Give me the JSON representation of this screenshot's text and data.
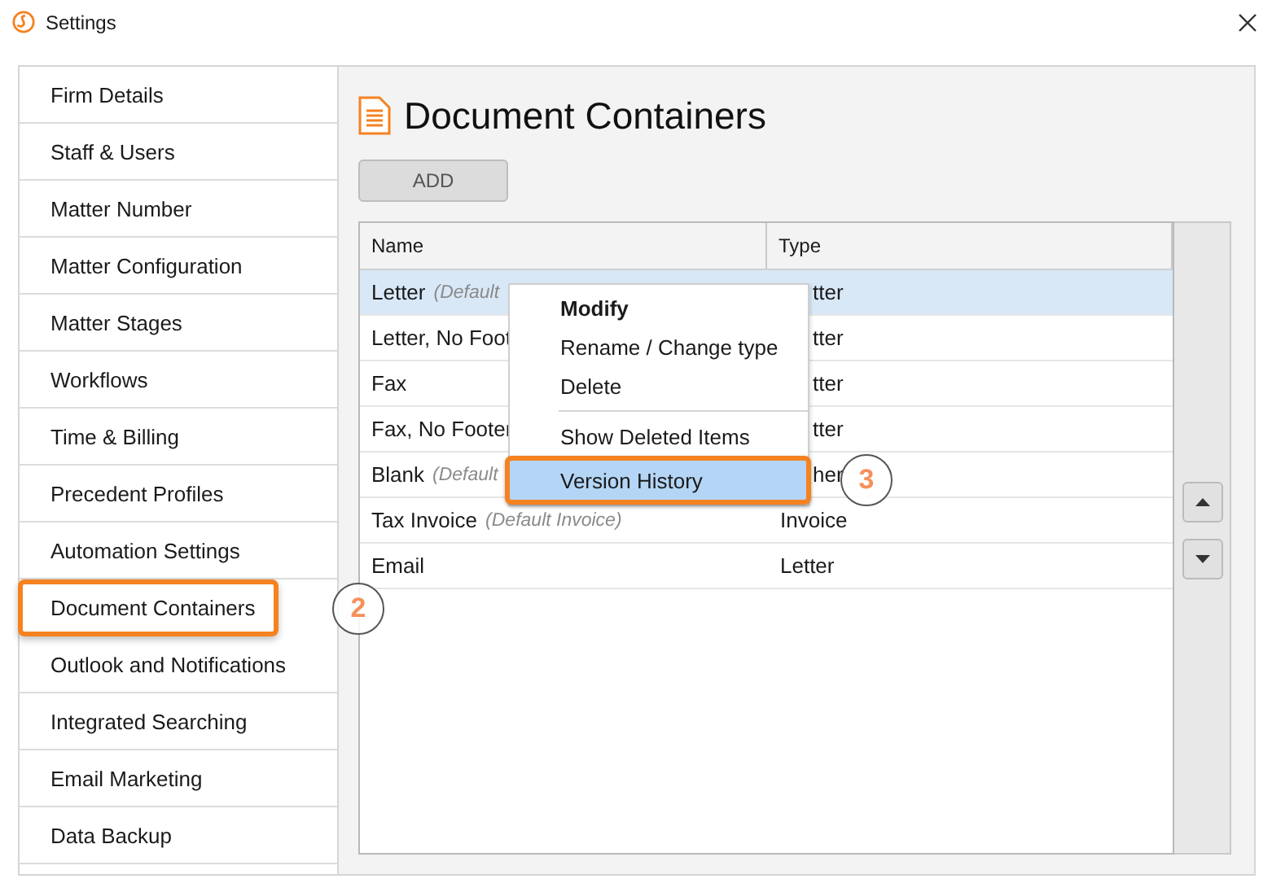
{
  "window": {
    "title": "Settings"
  },
  "sidebar": {
    "items": [
      {
        "label": "Firm Details",
        "selected": false
      },
      {
        "label": "Staff & Users",
        "selected": false
      },
      {
        "label": "Matter Number",
        "selected": false
      },
      {
        "label": "Matter Configuration",
        "selected": false
      },
      {
        "label": "Matter Stages",
        "selected": false
      },
      {
        "label": "Workflows",
        "selected": false
      },
      {
        "label": "Time & Billing",
        "selected": false
      },
      {
        "label": "Precedent Profiles",
        "selected": false
      },
      {
        "label": "Automation Settings",
        "selected": false
      },
      {
        "label": "Document Containers",
        "selected": true,
        "callout": "2"
      },
      {
        "label": "Outlook and Notifications",
        "selected": false
      },
      {
        "label": "Integrated Searching",
        "selected": false
      },
      {
        "label": "Email Marketing",
        "selected": false
      },
      {
        "label": "Data Backup",
        "selected": false
      }
    ]
  },
  "page": {
    "title": "Document Containers",
    "add_button": "ADD"
  },
  "table": {
    "columns": [
      "Name",
      "Type"
    ],
    "rows": [
      {
        "name": "Letter",
        "note": "(Default",
        "type": "tter",
        "type_clipped": true,
        "selected": true
      },
      {
        "name": "Letter, No Foot",
        "type": "tter",
        "type_clipped": true,
        "selected": false
      },
      {
        "name": "Fax",
        "type": "tter",
        "type_clipped": true,
        "selected": false
      },
      {
        "name": "Fax, No Footer",
        "type": "tter",
        "type_clipped": true,
        "selected": false
      },
      {
        "name": "Blank",
        "note": "(Default",
        "type": "her",
        "type_clipped": true,
        "selected": false
      },
      {
        "name": "Tax Invoice",
        "note": "(Default Invoice)",
        "type": "Invoice",
        "type_clipped": false,
        "selected": false
      },
      {
        "name": "Email",
        "type": "Letter",
        "type_clipped": false,
        "selected": false
      }
    ]
  },
  "context_menu": {
    "items": [
      {
        "label": "Modify",
        "kind": "default",
        "selected": false
      },
      {
        "label": "Rename / Change type",
        "kind": "normal",
        "selected": false
      },
      {
        "label": "Delete",
        "kind": "normal",
        "selected": false
      },
      {
        "kind": "separator"
      },
      {
        "label": "Show Deleted Items",
        "kind": "normal",
        "selected": false
      },
      {
        "label": "Version History",
        "kind": "normal",
        "selected": true,
        "callout": "3"
      }
    ]
  }
}
